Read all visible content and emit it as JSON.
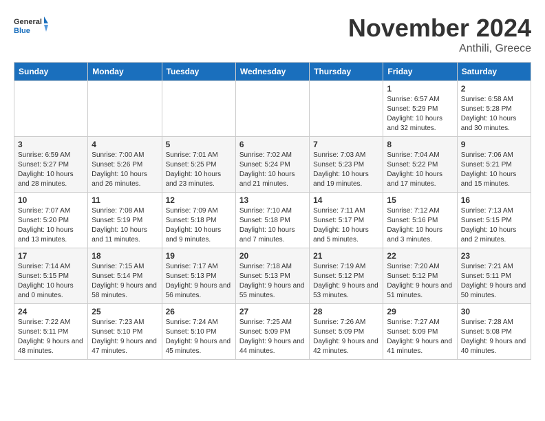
{
  "logo": {
    "line1": "General",
    "line2": "Blue"
  },
  "title": "November 2024",
  "subtitle": "Anthili, Greece",
  "days_of_week": [
    "Sunday",
    "Monday",
    "Tuesday",
    "Wednesday",
    "Thursday",
    "Friday",
    "Saturday"
  ],
  "weeks": [
    [
      {
        "day": "",
        "info": ""
      },
      {
        "day": "",
        "info": ""
      },
      {
        "day": "",
        "info": ""
      },
      {
        "day": "",
        "info": ""
      },
      {
        "day": "",
        "info": ""
      },
      {
        "day": "1",
        "info": "Sunrise: 6:57 AM\nSunset: 5:29 PM\nDaylight: 10 hours and 32 minutes."
      },
      {
        "day": "2",
        "info": "Sunrise: 6:58 AM\nSunset: 5:28 PM\nDaylight: 10 hours and 30 minutes."
      }
    ],
    [
      {
        "day": "3",
        "info": "Sunrise: 6:59 AM\nSunset: 5:27 PM\nDaylight: 10 hours and 28 minutes."
      },
      {
        "day": "4",
        "info": "Sunrise: 7:00 AM\nSunset: 5:26 PM\nDaylight: 10 hours and 26 minutes."
      },
      {
        "day": "5",
        "info": "Sunrise: 7:01 AM\nSunset: 5:25 PM\nDaylight: 10 hours and 23 minutes."
      },
      {
        "day": "6",
        "info": "Sunrise: 7:02 AM\nSunset: 5:24 PM\nDaylight: 10 hours and 21 minutes."
      },
      {
        "day": "7",
        "info": "Sunrise: 7:03 AM\nSunset: 5:23 PM\nDaylight: 10 hours and 19 minutes."
      },
      {
        "day": "8",
        "info": "Sunrise: 7:04 AM\nSunset: 5:22 PM\nDaylight: 10 hours and 17 minutes."
      },
      {
        "day": "9",
        "info": "Sunrise: 7:06 AM\nSunset: 5:21 PM\nDaylight: 10 hours and 15 minutes."
      }
    ],
    [
      {
        "day": "10",
        "info": "Sunrise: 7:07 AM\nSunset: 5:20 PM\nDaylight: 10 hours and 13 minutes."
      },
      {
        "day": "11",
        "info": "Sunrise: 7:08 AM\nSunset: 5:19 PM\nDaylight: 10 hours and 11 minutes."
      },
      {
        "day": "12",
        "info": "Sunrise: 7:09 AM\nSunset: 5:18 PM\nDaylight: 10 hours and 9 minutes."
      },
      {
        "day": "13",
        "info": "Sunrise: 7:10 AM\nSunset: 5:18 PM\nDaylight: 10 hours and 7 minutes."
      },
      {
        "day": "14",
        "info": "Sunrise: 7:11 AM\nSunset: 5:17 PM\nDaylight: 10 hours and 5 minutes."
      },
      {
        "day": "15",
        "info": "Sunrise: 7:12 AM\nSunset: 5:16 PM\nDaylight: 10 hours and 3 minutes."
      },
      {
        "day": "16",
        "info": "Sunrise: 7:13 AM\nSunset: 5:15 PM\nDaylight: 10 hours and 2 minutes."
      }
    ],
    [
      {
        "day": "17",
        "info": "Sunrise: 7:14 AM\nSunset: 5:15 PM\nDaylight: 10 hours and 0 minutes."
      },
      {
        "day": "18",
        "info": "Sunrise: 7:15 AM\nSunset: 5:14 PM\nDaylight: 9 hours and 58 minutes."
      },
      {
        "day": "19",
        "info": "Sunrise: 7:17 AM\nSunset: 5:13 PM\nDaylight: 9 hours and 56 minutes."
      },
      {
        "day": "20",
        "info": "Sunrise: 7:18 AM\nSunset: 5:13 PM\nDaylight: 9 hours and 55 minutes."
      },
      {
        "day": "21",
        "info": "Sunrise: 7:19 AM\nSunset: 5:12 PM\nDaylight: 9 hours and 53 minutes."
      },
      {
        "day": "22",
        "info": "Sunrise: 7:20 AM\nSunset: 5:12 PM\nDaylight: 9 hours and 51 minutes."
      },
      {
        "day": "23",
        "info": "Sunrise: 7:21 AM\nSunset: 5:11 PM\nDaylight: 9 hours and 50 minutes."
      }
    ],
    [
      {
        "day": "24",
        "info": "Sunrise: 7:22 AM\nSunset: 5:11 PM\nDaylight: 9 hours and 48 minutes."
      },
      {
        "day": "25",
        "info": "Sunrise: 7:23 AM\nSunset: 5:10 PM\nDaylight: 9 hours and 47 minutes."
      },
      {
        "day": "26",
        "info": "Sunrise: 7:24 AM\nSunset: 5:10 PM\nDaylight: 9 hours and 45 minutes."
      },
      {
        "day": "27",
        "info": "Sunrise: 7:25 AM\nSunset: 5:09 PM\nDaylight: 9 hours and 44 minutes."
      },
      {
        "day": "28",
        "info": "Sunrise: 7:26 AM\nSunset: 5:09 PM\nDaylight: 9 hours and 42 minutes."
      },
      {
        "day": "29",
        "info": "Sunrise: 7:27 AM\nSunset: 5:09 PM\nDaylight: 9 hours and 41 minutes."
      },
      {
        "day": "30",
        "info": "Sunrise: 7:28 AM\nSunset: 5:08 PM\nDaylight: 9 hours and 40 minutes."
      }
    ]
  ]
}
